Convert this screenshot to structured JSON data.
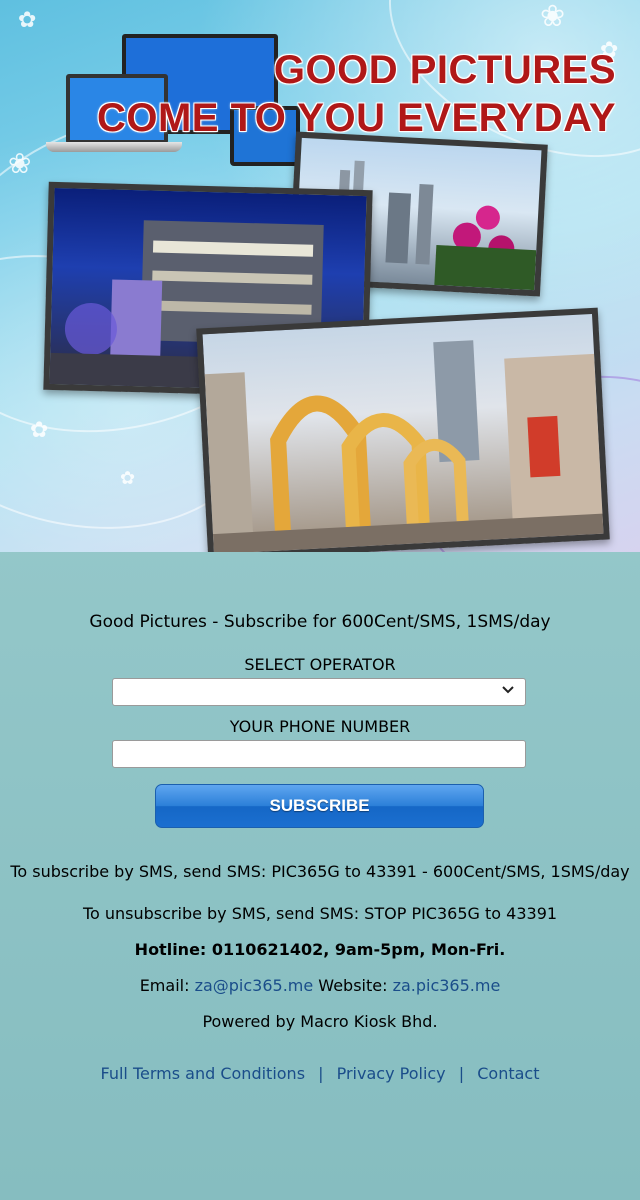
{
  "banner": {
    "headline_line1": "GOOD PICTURES",
    "headline_line2": "COME TO YOU EVERYDAY",
    "accent_color": "#b01818"
  },
  "form": {
    "tagline": "Good Pictures - Subscribe for 600Cent/SMS, 1SMS/day",
    "operator_label": "SELECT OPERATOR",
    "operator_value": "",
    "phone_label": "YOUR PHONE NUMBER",
    "phone_value": "",
    "subscribe_label": "SUBSCRIBE",
    "button_color": "#2b7fd8"
  },
  "info": {
    "subscribe_sms": "To subscribe by SMS, send SMS: PIC365G to 43391 - 600Cent/SMS, 1SMS/day",
    "unsubscribe_sms": "To unsubscribe by SMS, send SMS: STOP PIC365G to 43391",
    "hotline_label": "Hotline: ",
    "hotline_value": "0110621402, 9am-5pm, Mon-Fri.",
    "email_label": "Email: ",
    "email_value": "za@pic365.me",
    "website_label": " Website: ",
    "website_value": "za.pic365.me",
    "powered_by": "Powered by Macro Kiosk Bhd."
  },
  "footer": {
    "terms": "Full Terms and Conditions",
    "privacy": "Privacy Policy",
    "contact": "Contact",
    "separator": "|"
  }
}
